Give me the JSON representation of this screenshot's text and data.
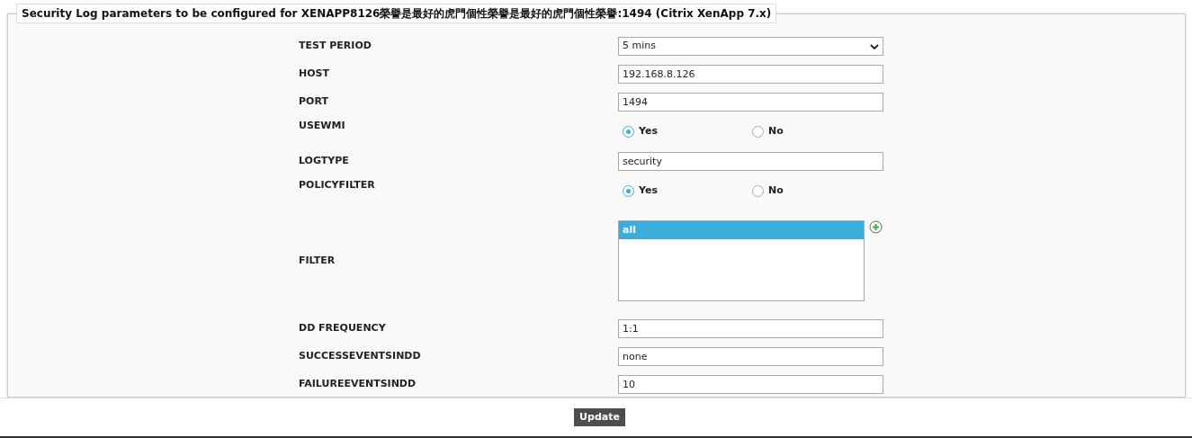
{
  "panel": {
    "legend": "Security Log parameters to be configured for XENAPP8126榮譽是最好的虎門個性榮譽是最好的虎門個性榮譽:1494 (Citrix XenApp 7.x)"
  },
  "fields": [
    {
      "label": "TEST PERIOD",
      "kind": "select",
      "value": "5 mins"
    },
    {
      "label": "HOST",
      "kind": "text",
      "value": "192.168.8.126"
    },
    {
      "label": "PORT",
      "kind": "text",
      "value": "1494"
    },
    {
      "label": "USEWMI",
      "kind": "radio",
      "options": [
        {
          "label": "Yes",
          "selected": true
        },
        {
          "label": "No",
          "selected": false
        }
      ]
    },
    {
      "label": "LOGTYPE",
      "kind": "text",
      "value": "security"
    },
    {
      "label": "POLICYFILTER",
      "kind": "radio",
      "options": [
        {
          "label": "Yes",
          "selected": true
        },
        {
          "label": "No",
          "selected": false
        }
      ]
    },
    {
      "label": "FILTER",
      "kind": "listbox",
      "items": [
        {
          "label": "all",
          "selected": true
        }
      ]
    },
    {
      "label": "DD FREQUENCY",
      "kind": "text",
      "value": "1:1"
    },
    {
      "label": "SUCCESSEVENTSINDD",
      "kind": "text",
      "value": "none"
    },
    {
      "label": "FAILUREEVENTSINDD",
      "kind": "text",
      "value": "10"
    }
  ],
  "footer": {
    "button": "Update"
  }
}
